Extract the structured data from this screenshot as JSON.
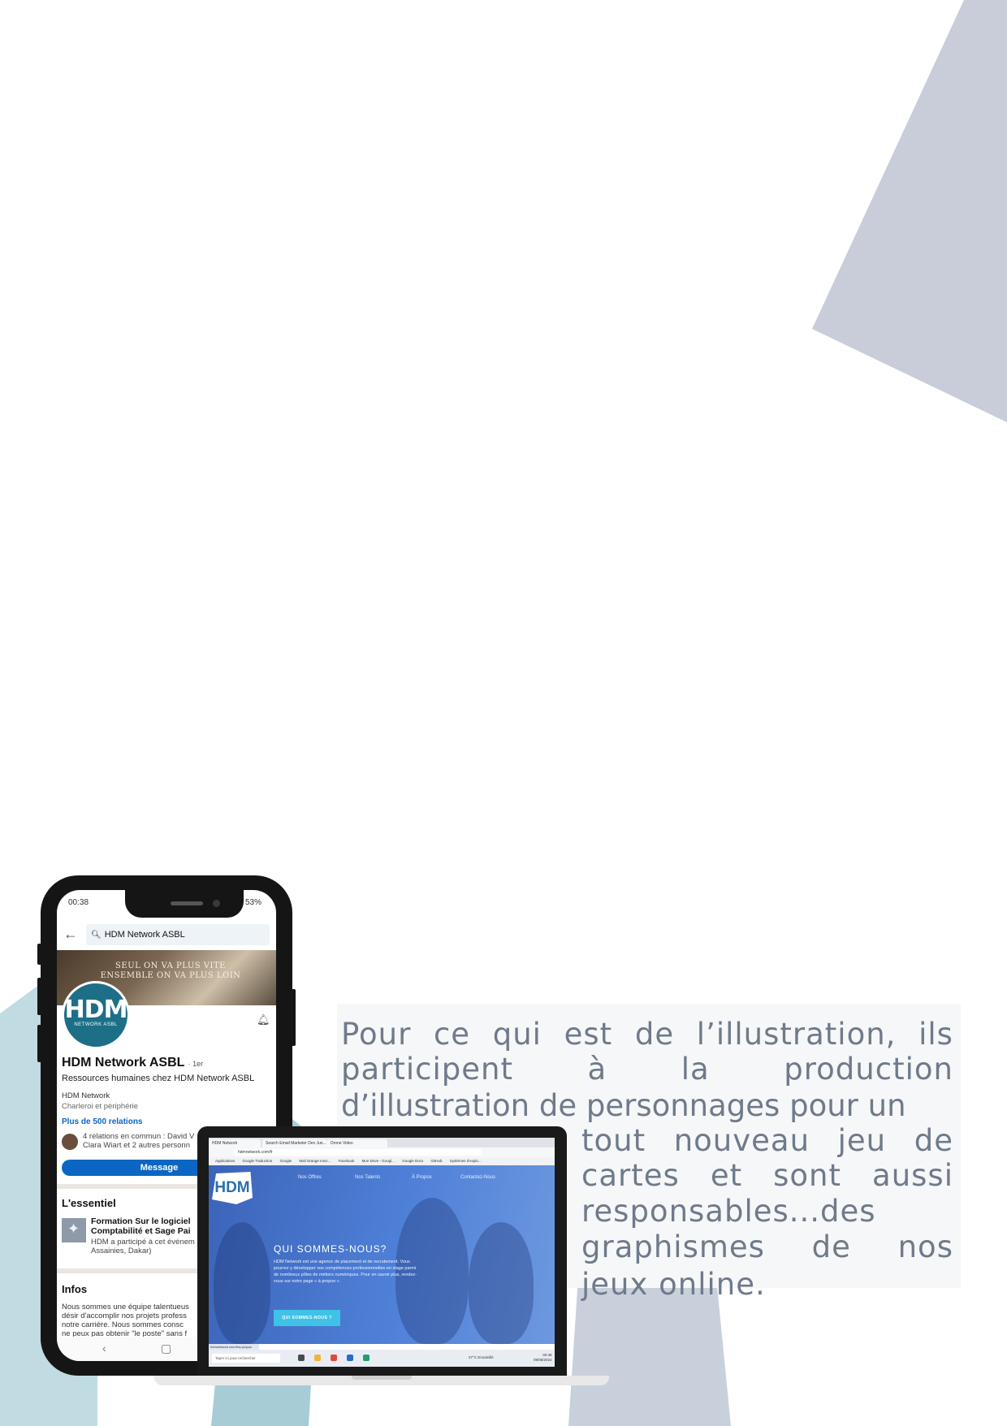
{
  "phone": {
    "status_time": "00:38",
    "status_battery": "53%",
    "search_query": "HDM Network ASBL",
    "cover_line1": "SEUL ON VA PLUS VITE",
    "cover_line2": "ENSEMBLE ON VA PLUS LOIN",
    "logo_text": "HDM",
    "logo_sub": "NETWORK ASBL",
    "name": "HDM Network ASBL",
    "degree": "· 1er",
    "headline": "Ressources humaines chez HDM Network ASBL",
    "company": "HDM Network",
    "location": "Charleroi et périphérie",
    "relations": "Plus de 500 relations",
    "common_line1": "4 relations en commun : David V",
    "common_line2": "Clara Wiart et 2 autres personn",
    "message_button": "Message",
    "essentiel_title": "L'essentiel",
    "essentiel_item_line1": "Formation Sur le logiciel",
    "essentiel_item_line2": "Comptabilité et Sage Pai",
    "essentiel_item_desc1": "HDM a participé à cet événem",
    "essentiel_item_desc2": "Assainies, Dakar)",
    "infos_title": "Infos",
    "infos_line1": "Nous sommes une équipe talentueus",
    "infos_line2": "désir d'accomplir nos projets profess",
    "infos_line3": "notre carrière.  Nous sommes consc",
    "infos_line4": "ne peux pas obtenir \"le poste\" sans f"
  },
  "laptop": {
    "tab1": "HDM Network",
    "tab2": "Search Email Marketer Dev Jun...",
    "tab3": "Drone Video",
    "url": "hdmnetwork.com/fr",
    "bookmarks": [
      "Applications",
      "Google Traduction",
      "Google",
      "Mail Orange Inscr...",
      "Facebook",
      "Mon Drive - Googl...",
      "Google Docs",
      "GitHub",
      "Systèmes d'explo..."
    ],
    "site_logo": "HDM",
    "nav": [
      "Nos Offres",
      "Nos Talents",
      "À Propos",
      "Contactez-Nous"
    ],
    "heading": "QUI SOMMES-NOUS?",
    "body": "HDM Network est une agence de placement et de recrutement. Vous pourrez y développer vos compétences professionnelles en stage parmi de nombreux pôles de métiers numériques. Pour en savoir plus, rendez-vous sur notre page « à propos ».",
    "cta": "QUI SOMMES-NOUS ?",
    "status_url": "hdmnetwork.com/fr/a-propos",
    "taskbar_search": "Taper ici pour rechercher",
    "weather": "27°C  Ensoleillé",
    "clock_time": "00:38",
    "clock_date": "09/08/2022"
  },
  "paragraph": {
    "lines": [
      [
        "Pour",
        "ce",
        "qui",
        "est",
        "de",
        "l’illustration,",
        "ils"
      ],
      [
        "participent",
        "à",
        "la",
        "production"
      ],
      [
        "d’illustration de personnages pour un"
      ],
      [
        "tout",
        "nouveau",
        "jeu",
        "de"
      ],
      [
        "cartes",
        "et",
        "sont",
        "aussi"
      ],
      [
        "responsables...des"
      ],
      [
        "graphismes",
        "de",
        "nos"
      ],
      [
        "jeux online."
      ]
    ]
  },
  "colors": {
    "triangle_top": "#c8cdd9",
    "triangle_bottom_light": "#c0dbe2",
    "triangle_bottom_mid": "#a7ccd6",
    "triangle_bottom_grey": "#c8d0dc",
    "paragraph_text": "#6f7a8a",
    "linkedin_blue": "#0a66c2"
  }
}
